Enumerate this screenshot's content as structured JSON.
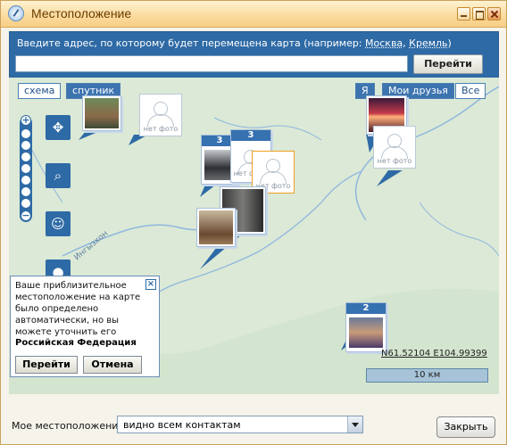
{
  "window": {
    "title": "Местоположение"
  },
  "address": {
    "prompt_prefix": "Введите адрес, по которому будет перемещена карта (например:",
    "example1": "Москва",
    "example2": "Кремль",
    "prompt_suffix": ")",
    "input_value": "",
    "go_label": "Перейти"
  },
  "map": {
    "tabs": {
      "scheme": "схема",
      "satellite": "спутник"
    },
    "filters": {
      "me": "Я",
      "friends": "Мои друзья",
      "all": "Все"
    },
    "no_photo": "нет фото",
    "clusters": [
      "3",
      "3",
      "2"
    ],
    "river_label": "Ингызхон",
    "coordinates": "N61.52104 E104.99399",
    "scale": "10 км"
  },
  "popup": {
    "text": "Ваше приблизительное местоположение на карте было определено автоматически, но вы можете уточнить его",
    "country": "Российская Федерация",
    "go": "Перейти",
    "cancel": "Отмена"
  },
  "footer": {
    "label": "Мое местоположение:",
    "visibility_value": "видно всем контактам",
    "close": "Закрыть"
  },
  "colors": {
    "accent": "#2e6aa5",
    "title_bg": "#fbdca0"
  }
}
